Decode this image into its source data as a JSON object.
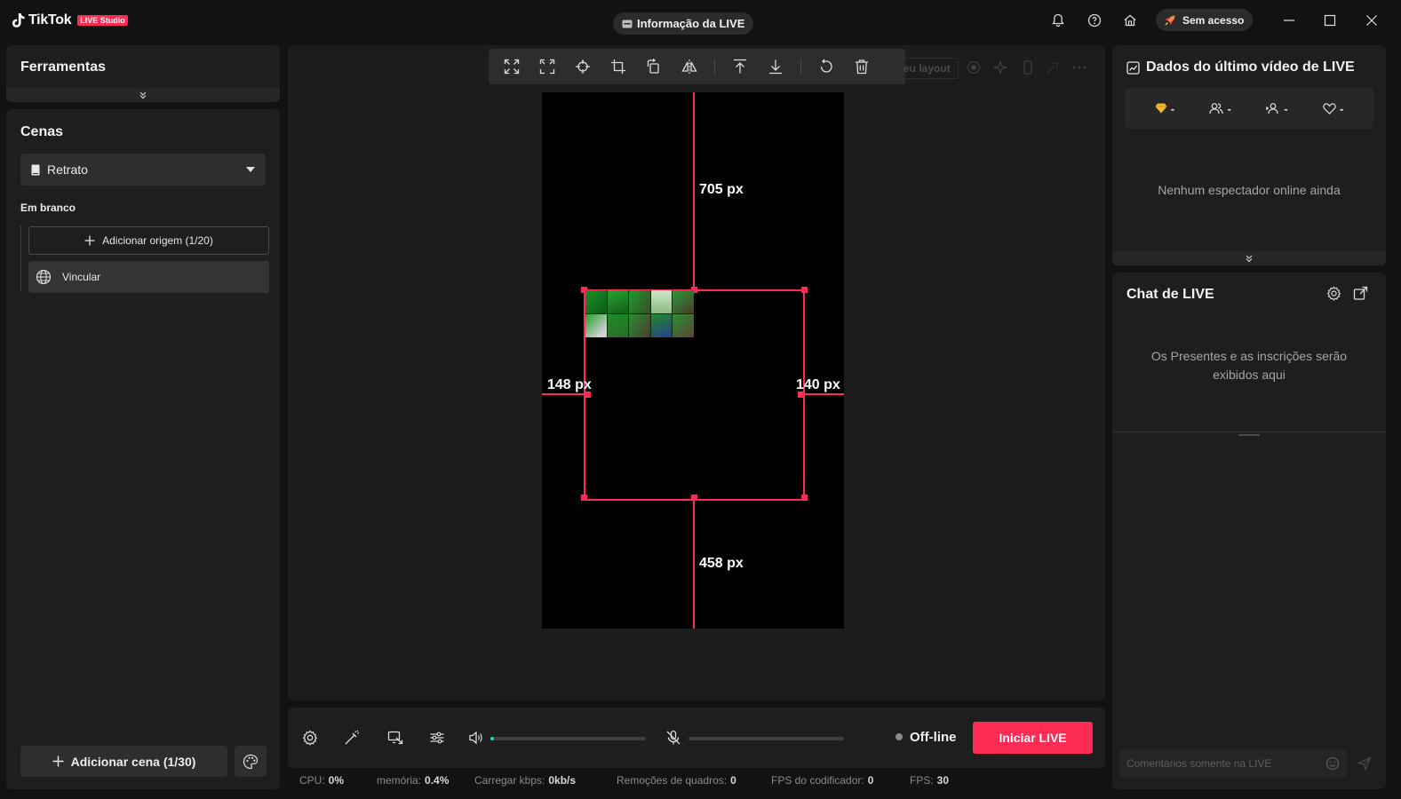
{
  "app": {
    "logo_text": "TikTok",
    "logo_badge": "LIVE Studio",
    "live_info_label": "Informação da LIVE",
    "access_label": "Sem acesso"
  },
  "tools": {
    "title": "Ferramentas"
  },
  "scenes": {
    "title": "Cenas",
    "selected_scene": "Retrato",
    "group_label": "Em branco",
    "add_source_label": "Adicionar origem (1/20)",
    "sources": [
      {
        "label": "Vincular",
        "icon": "globe-icon"
      }
    ],
    "add_scene_label": "Adicionar cena (1/30)"
  },
  "canvas": {
    "toolbar_hint": "eu layout",
    "toolbar_icons": [
      "fit-to-screen-icon",
      "fullscreen-icon",
      "center-icon",
      "crop-icon",
      "rotate-icon",
      "flip-icon",
      "bring-to-front-icon",
      "send-to-back-icon",
      "undo-icon",
      "delete-icon"
    ],
    "measurements": {
      "top": "705 px",
      "left": "148 px",
      "right": "140 px",
      "bottom": "458 px"
    }
  },
  "controls": {
    "status_label": "Off-line",
    "start_label": "Iniciar LIVE",
    "volume_level": 0.02,
    "mic_level": 0.0
  },
  "stats": [
    {
      "label": "CPU:",
      "value": "0%"
    },
    {
      "label": "memória:",
      "value": "0.4%"
    },
    {
      "label": "Carregar kbps:",
      "value": "0kb/s"
    },
    {
      "label": "Remoções de quadros:",
      "value": "0"
    },
    {
      "label": "FPS do codificador:",
      "value": "0"
    },
    {
      "label": "FPS:",
      "value": "30"
    }
  ],
  "last_live": {
    "title": "Dados do último vídeo de LIVE",
    "stats": [
      {
        "icon": "diamond-icon",
        "value": "-"
      },
      {
        "icon": "viewers-icon",
        "value": "-"
      },
      {
        "icon": "new-follower-icon",
        "value": "-"
      },
      {
        "icon": "heart-icon",
        "value": "-"
      }
    ],
    "empty_message": "Nenhum espectador online ainda"
  },
  "chat": {
    "title": "Chat de LIVE",
    "empty_message_line1": "Os Presentes e as inscrições serão",
    "empty_message_line2": "exibidos aqui",
    "input_placeholder": "Comentários somente na LIVE"
  },
  "colors": {
    "accent": "#fe2c55",
    "background": "#121212",
    "panel": "#1e1e1e"
  }
}
